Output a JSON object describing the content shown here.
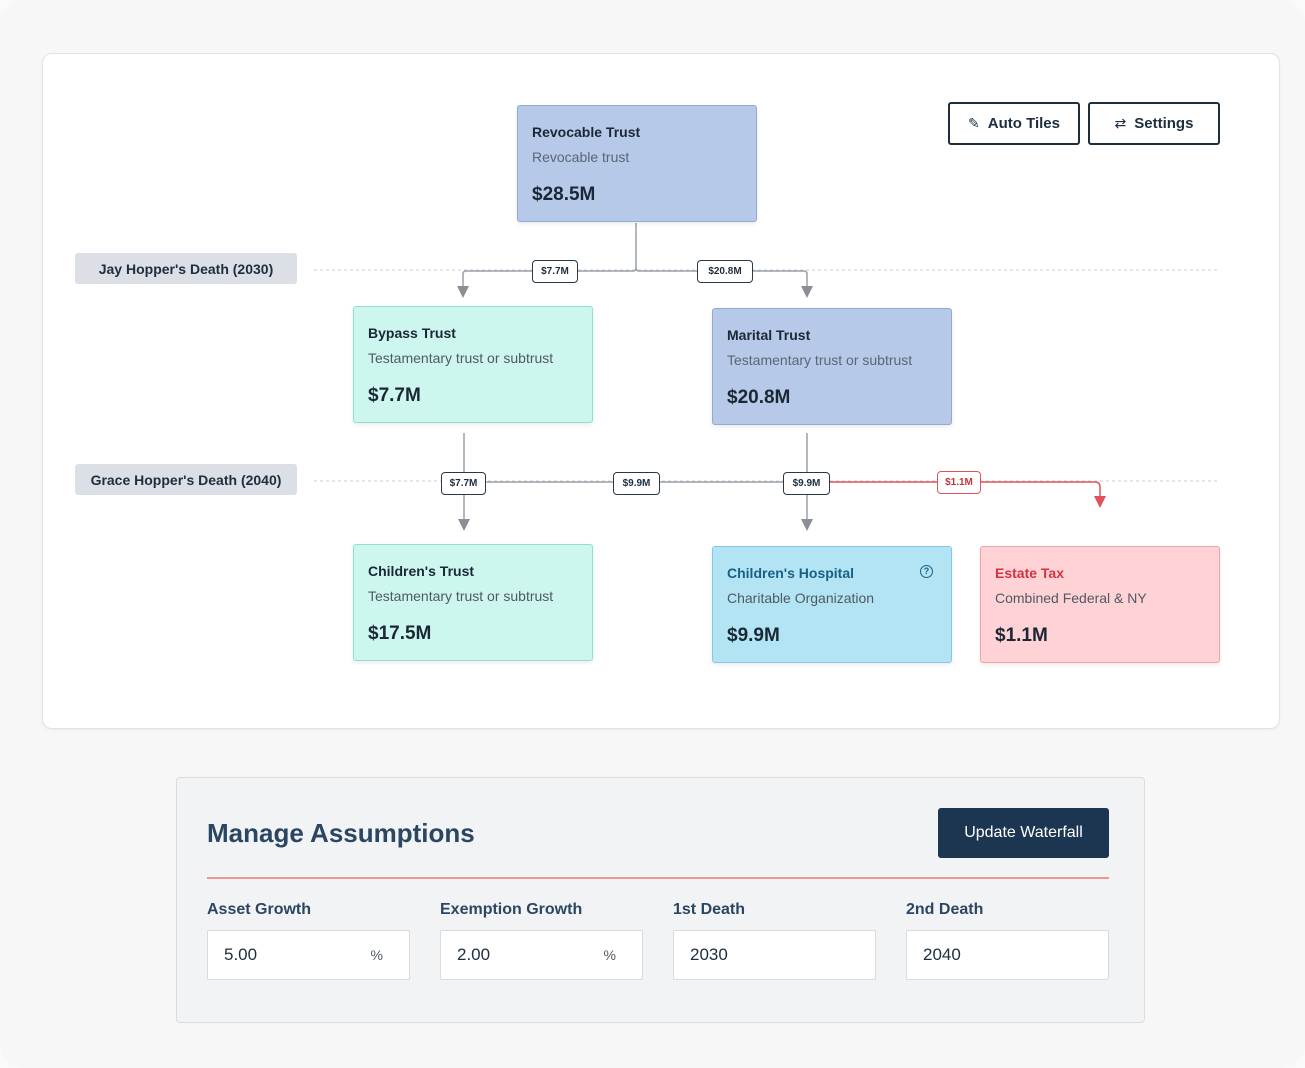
{
  "toolbar": {
    "auto_tiles_label": "Auto Tiles",
    "auto_tiles_icon": "magic-wand-icon",
    "settings_label": "Settings",
    "settings_icon": "swap-arrows-icon"
  },
  "events": [
    {
      "label": "Jay Hopper's Death (2030)"
    },
    {
      "label": "Grace Hopper's Death (2040)"
    }
  ],
  "nodes": {
    "revocable": {
      "title": "Revocable Trust",
      "subtitle": "Revocable trust",
      "amount": "$28.5M"
    },
    "bypass": {
      "title": "Bypass Trust",
      "subtitle": "Testamentary trust or subtrust",
      "amount": "$7.7M"
    },
    "marital": {
      "title": "Marital Trust",
      "subtitle": "Testamentary trust or subtrust",
      "amount": "$20.8M"
    },
    "childrens_trust": {
      "title": "Children's Trust",
      "subtitle": "Testamentary trust or subtrust",
      "amount": "$17.5M"
    },
    "childrens_hospital": {
      "title": "Children's Hospital",
      "subtitle": "Charitable Organization",
      "amount": "$9.9M"
    },
    "estate_tax": {
      "title": "Estate Tax",
      "subtitle": "Combined Federal & NY",
      "amount": "$1.1M"
    }
  },
  "flows": {
    "rev_to_bypass": "$7.7M",
    "rev_to_marital": "$20.8M",
    "bypass_to_children": "$7.7M",
    "marital_to_children": "$9.9M",
    "marital_to_hospital": "$9.9M",
    "marital_to_tax": "$1.1M"
  },
  "assumptions": {
    "title": "Manage Assumptions",
    "update_label": "Update Waterfall",
    "fields": [
      {
        "label": "Asset Growth",
        "value": "5.00",
        "unit": "%"
      },
      {
        "label": "Exemption Growth",
        "value": "2.00",
        "unit": "%"
      },
      {
        "label": "1st Death",
        "value": "2030",
        "unit": ""
      },
      {
        "label": "2nd Death",
        "value": "2040",
        "unit": ""
      }
    ]
  },
  "colors": {
    "trust_blue": "#b6c9e8",
    "trust_mint": "#cdf7ee",
    "charity_cyan": "#b3e4f4",
    "tax_red": "#ffd2d6",
    "accent_navy": "#1c3550"
  }
}
